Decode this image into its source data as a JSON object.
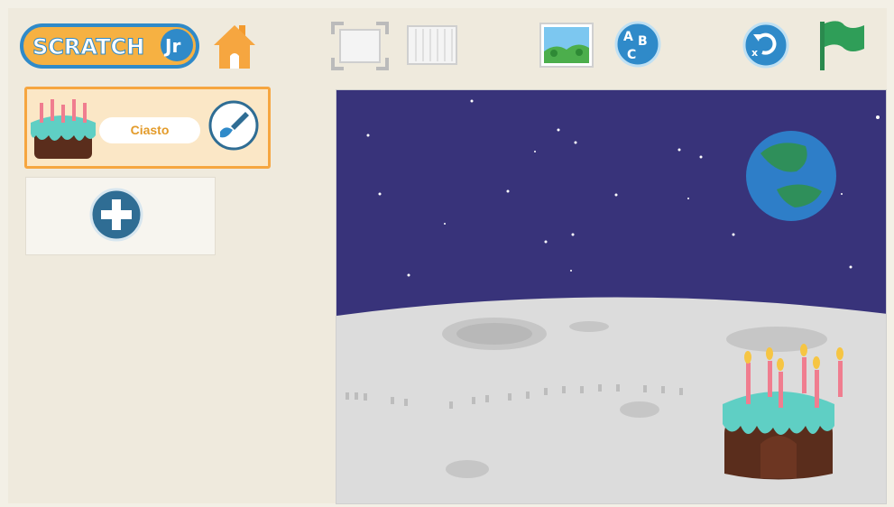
{
  "app": {
    "logo_text": "SCRATCH JR"
  },
  "toolbar": {
    "home": "home-icon",
    "fullscreen": "fullscreen-icon",
    "grid": "grid-icon",
    "background": "landscape-icon",
    "text": "abc-text-icon",
    "reset": "reset-icon",
    "green_flag": "green-flag-icon"
  },
  "sprites": [
    {
      "name": "Ciasto",
      "icon": "cake-icon",
      "edit_icon": "paintbrush-icon"
    }
  ],
  "add_sprite": {
    "icon": "plus-icon"
  },
  "stage": {
    "background": "moon-surface",
    "sprite": "birthday-cake",
    "colors": {
      "sky": "#38337a",
      "ground": "#dcdcdc",
      "earth_ocean": "#2e7ec8",
      "earth_land": "#2f8f5a"
    }
  },
  "colors": {
    "panel_orange": "#f6a640",
    "panel_cream": "#fbe7c6",
    "button_blue": "#2f8ac9",
    "flag_green": "#2f9e58"
  }
}
